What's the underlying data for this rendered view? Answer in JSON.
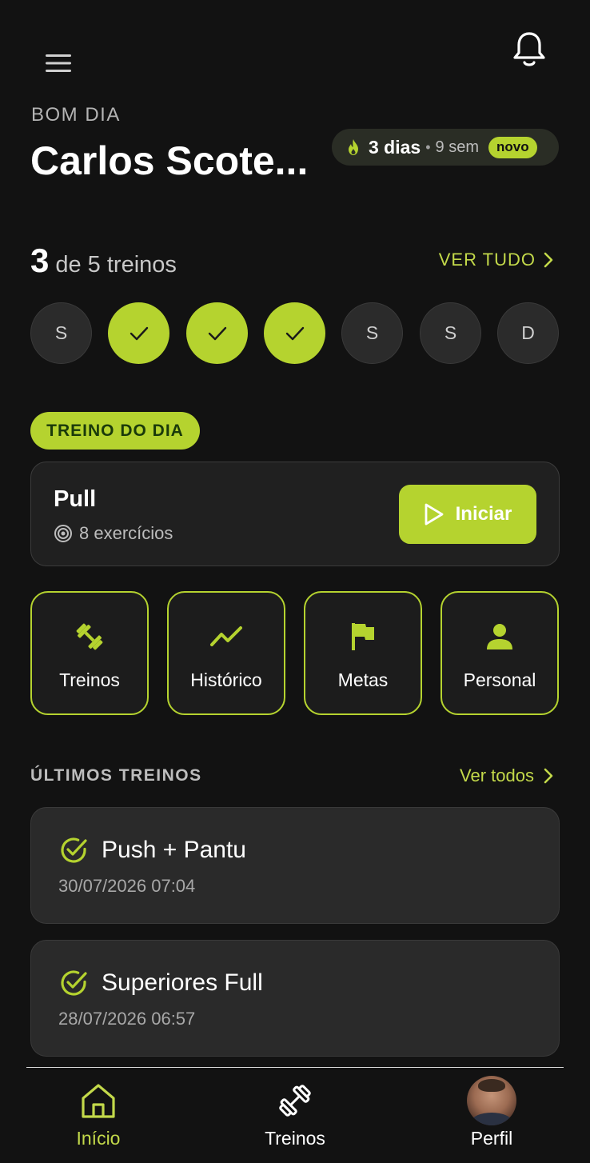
{
  "header": {
    "greeting": "BOM DIA",
    "user_name": "Carlos Scote...",
    "streak": {
      "days": "3 dias",
      "separator": "•",
      "weeks": "9 sem",
      "badge": "novo"
    }
  },
  "week_progress": {
    "done": "3",
    "rest": "de 5 treinos",
    "see_all": "VER TUDO",
    "days": [
      {
        "label": "S",
        "done": false
      },
      {
        "label": "",
        "done": true
      },
      {
        "label": "",
        "done": true
      },
      {
        "label": "",
        "done": true
      },
      {
        "label": "S",
        "done": false
      },
      {
        "label": "S",
        "done": false
      },
      {
        "label": "D",
        "done": false
      }
    ]
  },
  "workout_of_day": {
    "pill": "TREINO DO DIA",
    "title": "Pull",
    "exercises": "8 exercícios",
    "start_label": "Iniciar"
  },
  "quick_actions": [
    {
      "label": "Treinos",
      "icon": "dumbbell-icon"
    },
    {
      "label": "Histórico",
      "icon": "trend-icon"
    },
    {
      "label": "Metas",
      "icon": "flag-icon"
    },
    {
      "label": "Personal",
      "icon": "person-icon"
    }
  ],
  "recent": {
    "title": "ÚLTIMOS TREINOS",
    "see_all": "Ver todos",
    "items": [
      {
        "title": "Push + Pantu",
        "date": "30/07/2026 07:04"
      },
      {
        "title": "Superiores Full",
        "date": "28/07/2026 06:57"
      }
    ]
  },
  "bottom_nav": {
    "home": "Início",
    "workouts": "Treinos",
    "profile": "Perfil"
  },
  "colors": {
    "accent": "#b5d32f",
    "background": "#121212",
    "card": "#2a2a2a"
  }
}
